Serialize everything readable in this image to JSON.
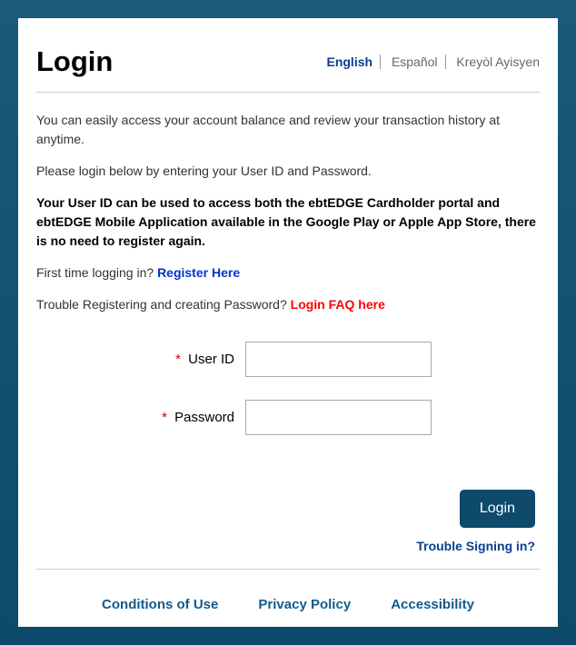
{
  "header": {
    "title": "Login",
    "languages": {
      "english": "English",
      "espanol": "Español",
      "kreyol": "Kreyòl Ayisyen"
    }
  },
  "intro": {
    "line1": "You can easily access your account balance and review your transaction history at anytime.",
    "line2": "Please login below by entering your User ID and Password.",
    "line3_bold": "Your User ID can be used to access both the ebtEDGE Cardholder portal and ebtEDGE Mobile Application available in the Google Play or Apple App Store, there is no need to register again.",
    "first_time_prefix": "First time logging in? ",
    "register_link": "Register Here",
    "trouble_prefix": "Trouble Registering and creating Password? ",
    "faq_link": "Login FAQ here"
  },
  "form": {
    "required_marker": "*",
    "user_id_label": "User ID",
    "user_id_value": "",
    "password_label": "Password",
    "password_value": "",
    "login_button": "Login",
    "trouble_signing_in": "Trouble Signing in?"
  },
  "footer": {
    "conditions": "Conditions of Use",
    "privacy": "Privacy Policy",
    "accessibility": "Accessibility"
  }
}
